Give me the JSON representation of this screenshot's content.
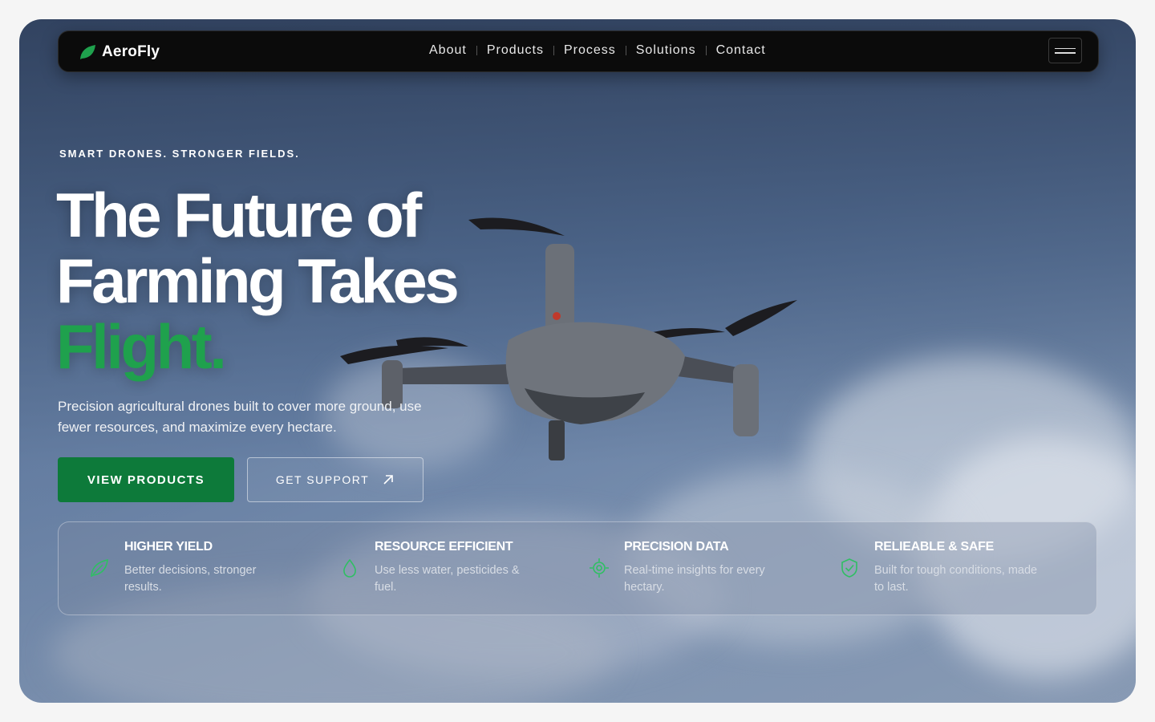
{
  "brand": {
    "name": "AeroFly",
    "logo_icon": "leaf-icon",
    "accent": "#1fa14d"
  },
  "nav": {
    "links": [
      "About",
      "Products",
      "Process",
      "Solutions",
      "Contact"
    ],
    "menu_icon": "hamburger-icon"
  },
  "hero": {
    "eyebrow": "SMART DRONES. STRONGER FIELDS.",
    "title_line1": "The Future of",
    "title_line2": "Farming Takes",
    "title_highlight": "Flight.",
    "subtitle": "Precision agricultural drones built to cover more ground, use fewer resources, and maximize every hectare.",
    "primary_cta": "VIEW PRODUCTS",
    "secondary_cta": "GET SUPPORT",
    "secondary_cta_icon": "arrow-up-right-icon",
    "primary_color": "#0d7a3a"
  },
  "features": [
    {
      "icon": "leaf-icon",
      "title": "HIGHER YIELD",
      "text": "Better decisions, stronger results."
    },
    {
      "icon": "water-drop-icon",
      "title": "RESOURCE EFFICIENT",
      "text": "Use less water, pesticides & fuel."
    },
    {
      "icon": "target-icon",
      "title": "PRECISION DATA",
      "text": "Real-time insights for every hectary."
    },
    {
      "icon": "shield-check-icon",
      "title": "RELIEABLE & SAFE",
      "text": "Built for tough conditions, made to last."
    }
  ]
}
